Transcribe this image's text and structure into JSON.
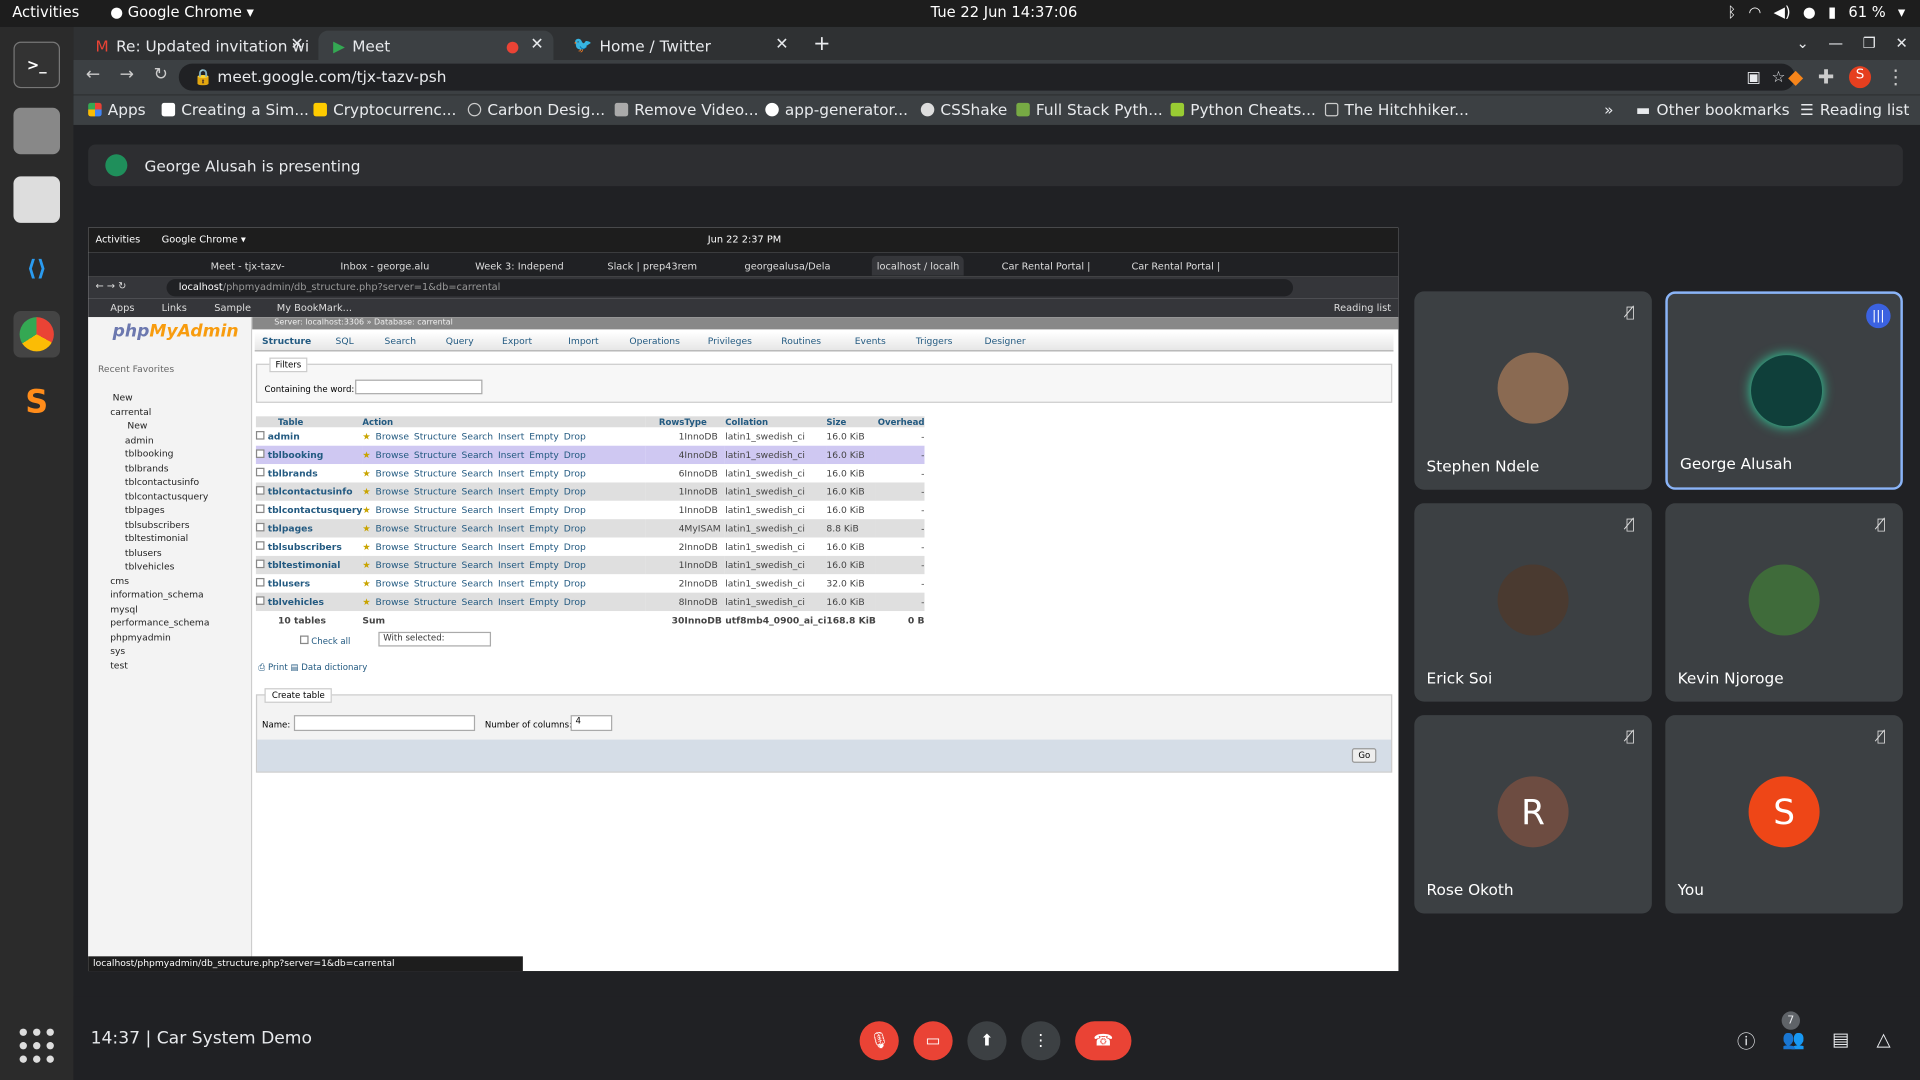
{
  "os": {
    "activities": "Activities",
    "app": "Google Chrome",
    "datetime": "Tue 22 Jun  14:37:06",
    "battery": "61 %"
  },
  "chrome": {
    "tabs": [
      "Re: Updated invitation wi",
      "Meet",
      "Home / Twitter"
    ],
    "url": "meet.google.com/tjx-tazv-psh",
    "bookmarks": [
      "Apps",
      "Creating a Sim...",
      "Cryptocurrenc...",
      "Carbon Desig...",
      "Remove Video...",
      "app-generator...",
      "CSShake",
      "Full Stack Pyth...",
      "Python Cheats...",
      "The Hitchhiker...",
      "»",
      "Other bookmarks",
      "Reading list"
    ]
  },
  "meet": {
    "banner": "George Alusah is presenting",
    "time": "14:37",
    "separator": "|",
    "title": "Car System Demo",
    "participants_count": "7",
    "tiles": [
      {
        "name": "Stephen Ndele",
        "initial": ""
      },
      {
        "name": "George Alusah",
        "initial": ""
      },
      {
        "name": "Erick Soi",
        "initial": ""
      },
      {
        "name": "Kevin Njoroge",
        "initial": ""
      },
      {
        "name": "Rose Okoth",
        "initial": "R"
      },
      {
        "name": "You",
        "initial": "S"
      }
    ]
  },
  "inner": {
    "activities": "Activities",
    "app": "Google Chrome ▾",
    "datetime": "Jun 22   2:37 PM",
    "tabs": [
      "Meet - tjx-tazv-",
      "Inbox - george.alu",
      "Week 3: Independ",
      "Slack | prep43rem",
      "georgealusa/Dela",
      "localhost / localh",
      "Car Rental Portal |",
      "Car Rental Portal |"
    ],
    "url_host": "localhost",
    "url_path": "/phpmyadmin/db_structure.php?server=1&db=carrental",
    "bookmarks": [
      "Apps",
      "Links",
      "Sample",
      "My BookMark...",
      "Reading list"
    ],
    "status_url": "localhost/phpmyadmin/db_structure.php?server=1&db=carrental"
  },
  "pma": {
    "logo_a": "php",
    "logo_b": "MyAdmin",
    "recent": "Recent",
    "favorites": "Favorites",
    "crumb": "Server: localhost:3306 » Database: carrental",
    "tree": [
      "New",
      "carrental",
      "New",
      "admin",
      "tblbooking",
      "tblbrands",
      "tblcontactusinfo",
      "tblcontactusquery",
      "tblpages",
      "tblsubscribers",
      "tbltestimonial",
      "tblusers",
      "tblvehicles",
      "cms",
      "information_schema",
      "mysql",
      "performance_schema",
      "phpmyadmin",
      "sys",
      "test"
    ],
    "tabs": [
      "Structure",
      "SQL",
      "Search",
      "Query",
      "Export",
      "Import",
      "Operations",
      "Privileges",
      "Routines",
      "Events",
      "Triggers",
      "Designer"
    ],
    "filters_title": "Filters",
    "filters_label": "Containing the word:",
    "headers": [
      "Table",
      "Action",
      "Rows",
      "Type",
      "Collation",
      "Size",
      "Overhead"
    ],
    "actions": [
      "Browse",
      "Structure",
      "Search",
      "Insert",
      "Empty",
      "Drop"
    ],
    "rows": [
      {
        "n": "admin",
        "r": "1",
        "t": "InnoDB",
        "c": "latin1_swedish_ci",
        "s": "16.0 KiB",
        "o": "-"
      },
      {
        "n": "tblbooking",
        "r": "4",
        "t": "InnoDB",
        "c": "latin1_swedish_ci",
        "s": "16.0 KiB",
        "o": "-"
      },
      {
        "n": "tblbrands",
        "r": "6",
        "t": "InnoDB",
        "c": "latin1_swedish_ci",
        "s": "16.0 KiB",
        "o": "-"
      },
      {
        "n": "tblcontactusinfo",
        "r": "1",
        "t": "InnoDB",
        "c": "latin1_swedish_ci",
        "s": "16.0 KiB",
        "o": "-"
      },
      {
        "n": "tblcontactusquery",
        "r": "1",
        "t": "InnoDB",
        "c": "latin1_swedish_ci",
        "s": "16.0 KiB",
        "o": "-"
      },
      {
        "n": "tblpages",
        "r": "4",
        "t": "MyISAM",
        "c": "latin1_swedish_ci",
        "s": "8.8 KiB",
        "o": "-"
      },
      {
        "n": "tblsubscribers",
        "r": "2",
        "t": "InnoDB",
        "c": "latin1_swedish_ci",
        "s": "16.0 KiB",
        "o": "-"
      },
      {
        "n": "tbltestimonial",
        "r": "1",
        "t": "InnoDB",
        "c": "latin1_swedish_ci",
        "s": "16.0 KiB",
        "o": "-"
      },
      {
        "n": "tblusers",
        "r": "2",
        "t": "InnoDB",
        "c": "latin1_swedish_ci",
        "s": "32.0 KiB",
        "o": "-"
      },
      {
        "n": "tblvehicles",
        "r": "8",
        "t": "InnoDB",
        "c": "latin1_swedish_ci",
        "s": "16.0 KiB",
        "o": "-"
      }
    ],
    "sum": {
      "n": "10 tables",
      "a": "Sum",
      "r": "30",
      "t": "InnoDB",
      "c": "utf8mb4_0900_ai_ci",
      "s": "168.8 KiB",
      "o": "0 B"
    },
    "check_all": "Check all",
    "with_selected": "With selected:",
    "print": "Print",
    "data_dictionary": "Data dictionary",
    "create_table": "Create table",
    "name_label": "Name:",
    "columns_label": "Number of columns:",
    "columns_value": "4",
    "go": "Go"
  }
}
